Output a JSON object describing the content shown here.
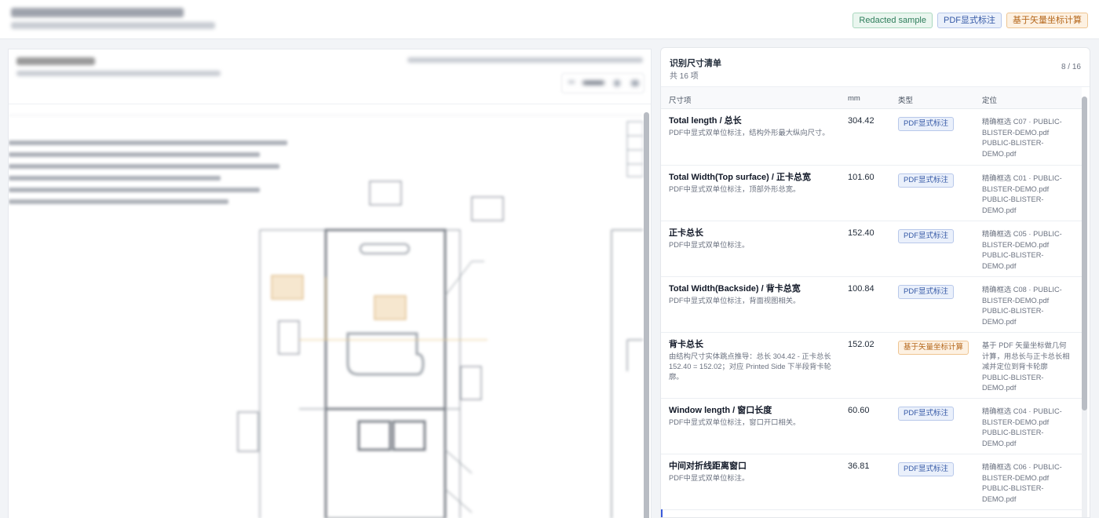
{
  "header": {
    "badges": [
      {
        "label": "Redacted sample",
        "tone": "green"
      },
      {
        "label": "PDF显式标注",
        "tone": "blue"
      },
      {
        "label": "基于矢量坐标计算",
        "tone": "orange"
      }
    ]
  },
  "list": {
    "title": "识别尺寸清单",
    "count": "共 16 项",
    "pager": "8 / 16",
    "columns": {
      "name": "尺寸项",
      "mm": "mm",
      "type": "类型",
      "loc": "定位"
    },
    "rows": [
      {
        "name": "Total length / 总长",
        "desc": "PDF中显式双单位标注，结构外形最大纵向尺寸。",
        "mm": "304.42",
        "type": "PDF显式标注",
        "tone": "blue",
        "loc": "精确框选 C07 · PUBLIC-BLISTER-DEMO.pdf PUBLIC-BLISTER-DEMO.pdf"
      },
      {
        "name": "Total Width(Top surface) / 正卡总宽",
        "desc": "PDF中显式双单位标注，顶部外形总宽。",
        "mm": "101.60",
        "type": "PDF显式标注",
        "tone": "blue",
        "loc": "精确框选 C01 · PUBLIC-BLISTER-DEMO.pdf PUBLIC-BLISTER-DEMO.pdf"
      },
      {
        "name": "正卡总长",
        "desc": "PDF中显式双单位标注。",
        "mm": "152.40",
        "type": "PDF显式标注",
        "tone": "blue",
        "loc": "精确框选 C05 · PUBLIC-BLISTER-DEMO.pdf PUBLIC-BLISTER-DEMO.pdf"
      },
      {
        "name": "Total Width(Backside) / 背卡总宽",
        "desc": "PDF中显式双单位标注，背面视图相关。",
        "mm": "100.84",
        "type": "PDF显式标注",
        "tone": "blue",
        "loc": "精确框选 C08 · PUBLIC-BLISTER-DEMO.pdf PUBLIC-BLISTER-DEMO.pdf"
      },
      {
        "name": "背卡总长",
        "desc": "由结构尺寸实体跳点推导：总长 304.42 - 正卡总长 152.40 = 152.02；对应 Printed Side 下半段背卡轮廓。",
        "mm": "152.02",
        "type": "基于矢量坐标计算",
        "tone": "orange",
        "loc": "基于 PDF 矢量坐标做几何计算，用总长与正卡总长相减并定位到背卡轮廓 PUBLIC-BLISTER-DEMO.pdf"
      },
      {
        "name": "Window length / 窗口长度",
        "desc": "PDF中显式双单位标注，窗口开口相关。",
        "mm": "60.60",
        "type": "PDF显式标注",
        "tone": "blue",
        "loc": "精确框选 C04 · PUBLIC-BLISTER-DEMO.pdf PUBLIC-BLISTER-DEMO.pdf"
      },
      {
        "name": "中间对折线距离窗口",
        "desc": "PDF中显式双单位标注。",
        "mm": "36.81",
        "type": "PDF显式标注",
        "tone": "blue",
        "loc": "精确框选 C06 · PUBLIC-BLISTER-DEMO.pdf PUBLIC-BLISTER-DEMO.pdf"
      }
    ]
  }
}
